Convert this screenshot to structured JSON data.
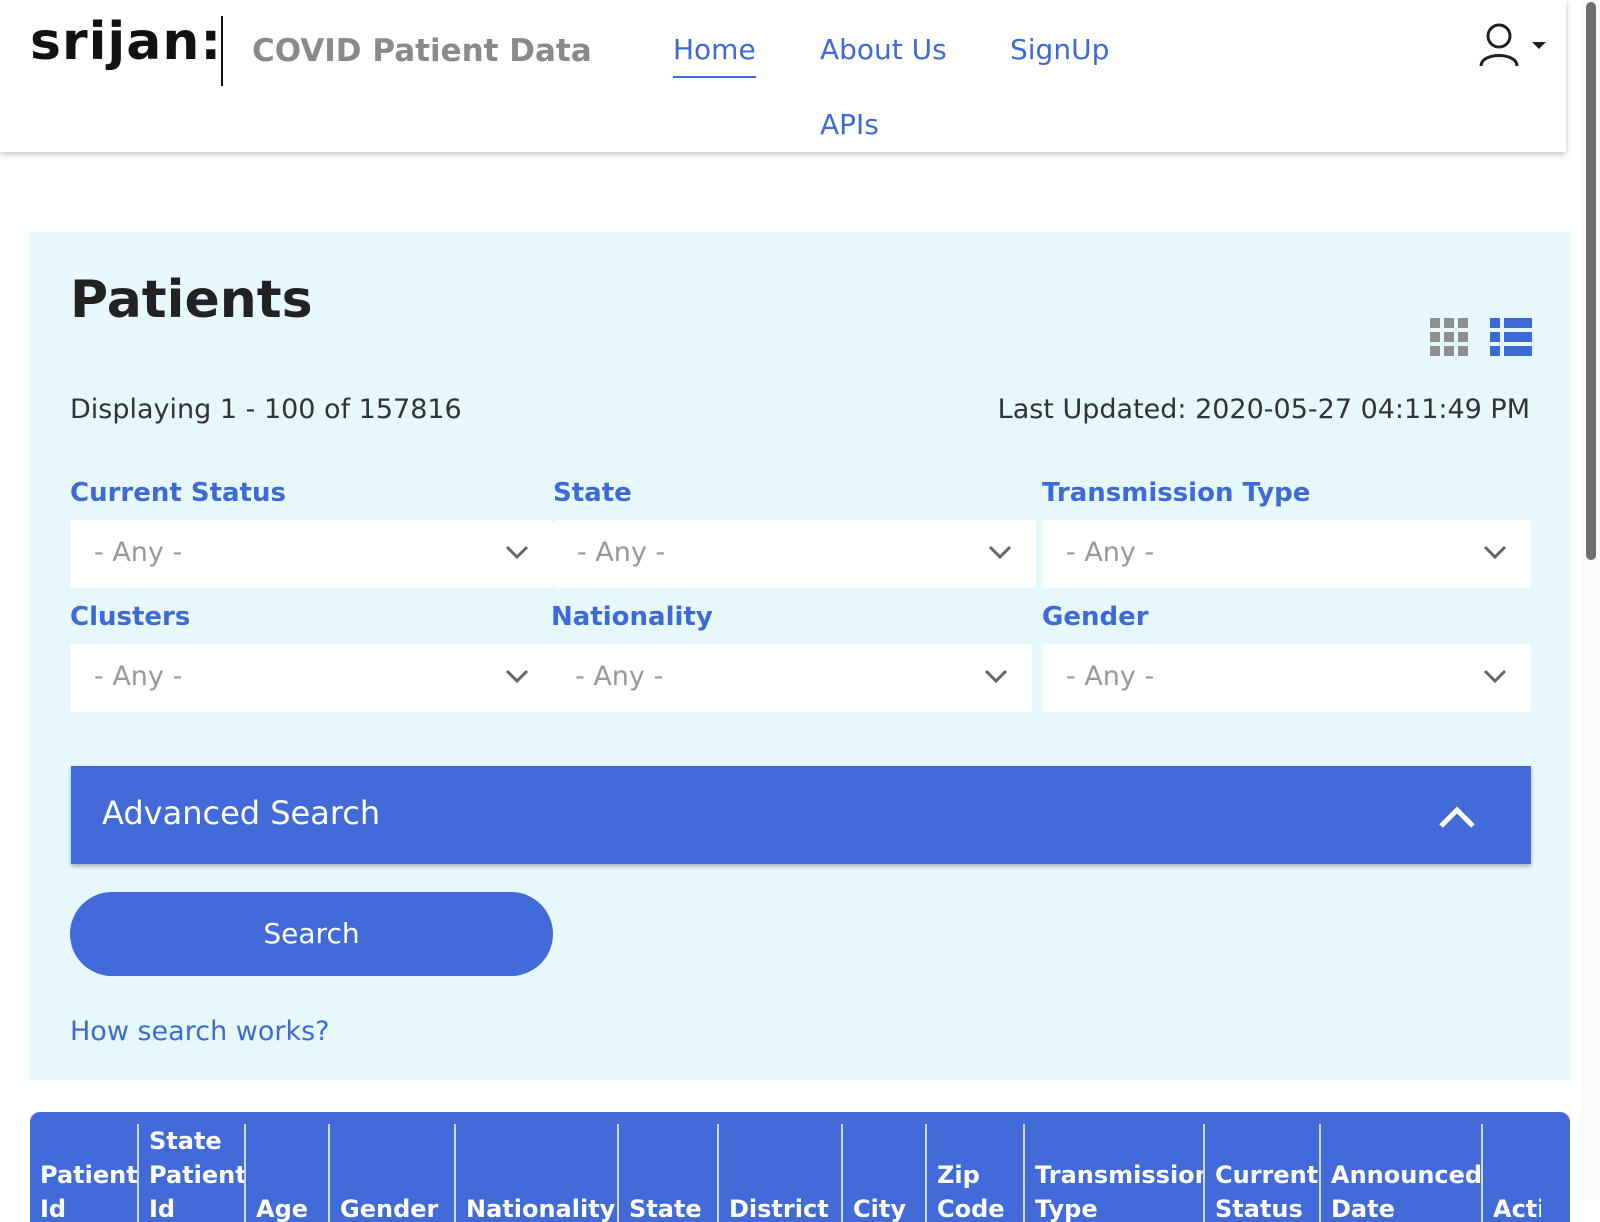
{
  "header": {
    "logo": "srijan:",
    "site_title": "COVID Patient Data",
    "nav": {
      "home": "Home",
      "about": "About Us",
      "signup": "SignUp",
      "apis": "APIs"
    },
    "user_icon": "user-icon"
  },
  "main": {
    "title": "Patients",
    "view_modes": [
      "grid-view-icon",
      "list-view-icon"
    ],
    "displaying": "Displaying 1 - 100 of 157816",
    "last_updated": "Last Updated: 2020-05-27 04:11:49 PM",
    "filters": {
      "current_status": {
        "label": "Current Status",
        "value": "- Any -"
      },
      "state": {
        "label": "State",
        "value": "- Any -"
      },
      "transmission_type": {
        "label": "Transmission Type",
        "value": "- Any -"
      },
      "clusters": {
        "label": "Clusters",
        "value": "- Any -"
      },
      "nationality": {
        "label": "Nationality",
        "value": "- Any -"
      },
      "gender": {
        "label": "Gender",
        "value": "- Any -"
      }
    },
    "advanced_search": "Advanced Search",
    "search_button": "Search",
    "how_search_works": "How search works?"
  },
  "table": {
    "columns": [
      {
        "lines": [
          "",
          "Patient",
          "Id"
        ]
      },
      {
        "lines": [
          "State",
          "Patient",
          "Id"
        ]
      },
      {
        "lines": [
          "",
          "",
          "Age"
        ]
      },
      {
        "lines": [
          "",
          "",
          "Gender"
        ]
      },
      {
        "lines": [
          "",
          "",
          "Nationality"
        ]
      },
      {
        "lines": [
          "",
          "",
          "State"
        ]
      },
      {
        "lines": [
          "",
          "",
          "District"
        ]
      },
      {
        "lines": [
          "",
          "",
          "City"
        ]
      },
      {
        "lines": [
          "",
          "Zip",
          "Code"
        ]
      },
      {
        "lines": [
          "",
          "Transmission",
          "Type"
        ]
      },
      {
        "lines": [
          "",
          "Current",
          "Status"
        ]
      },
      {
        "lines": [
          "",
          "Announced",
          "Date"
        ]
      },
      {
        "lines": [
          "",
          "",
          "Action"
        ]
      }
    ]
  },
  "colors": {
    "accent": "#426ad9",
    "link": "#3d6ad6",
    "panel_bg": "#e6f8fb"
  }
}
